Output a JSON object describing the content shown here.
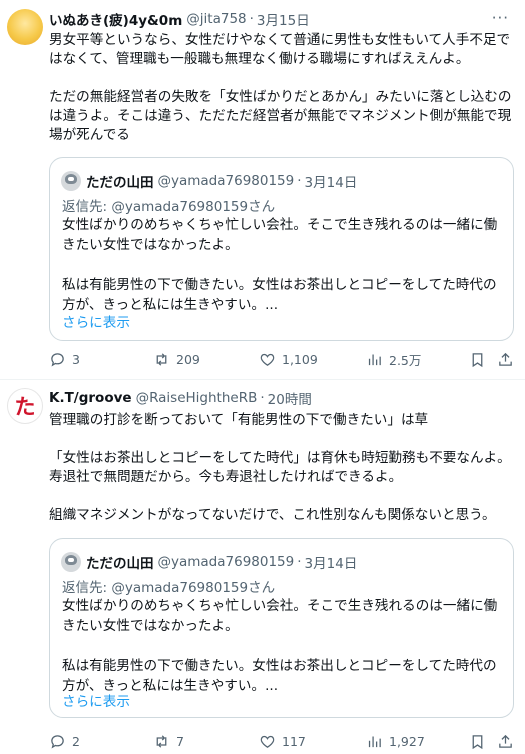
{
  "tweets": [
    {
      "display_name": "いぬあき(疲)4y&0m",
      "handle": "@jita758",
      "time": "3月15日",
      "text": "男女平等というなら、女性だけやなくて普通に男性も女性もいて人手不足ではなくて、管理職も一般職も無理なく働ける職場にすればええんよ。\n\nただの無能経営者の失敗を「女性ばかりだとあかん」みたいに落とし込むのは違うよ。そこは違う、ただただ経営者が無能でマネジメント側が無能で現場が死んでる",
      "quote": {
        "display_name": "ただの山田",
        "handle": "@yamada76980159",
        "time": "3月14日",
        "reply_label": "返信先: ",
        "reply_to": "@yamada76980159さん",
        "text": "女性ばかりのめちゃくちゃ忙しい会社。そこで生き残れるのは一緒に働きたい女性ではなかったよ。\n\n私は有能男性の下で働きたい。女性はお茶出しとコピーをしてた時代の方が、きっと私には生きやすい。...",
        "show_more": "さらに表示"
      },
      "stats": {
        "replies": "3",
        "retweets": "209",
        "likes": "1,109",
        "views": "2.5万"
      }
    },
    {
      "display_name": "K.T/groove",
      "handle": "@RaiseHightheRB",
      "time": "20時間",
      "avatar_glyph": "た",
      "text": "管理職の打診を断っておいて「有能男性の下で働きたい」は草\n\n「女性はお茶出しとコピーをしてた時代」は育休も時短勤務も不要なんよ。寿退社で無問題だから。今も寿退社したければできるよ。\n\n組織マネジメントがなってないだけで、これ性別なんも関係ないと思う。",
      "quote": {
        "display_name": "ただの山田",
        "handle": "@yamada76980159",
        "time": "3月14日",
        "reply_label": "返信先: ",
        "reply_to": "@yamada76980159さん",
        "text": "女性ばかりのめちゃくちゃ忙しい会社。そこで生き残れるのは一緒に働きたい女性ではなかったよ。\n\n私は有能男性の下で働きたい。女性はお茶出しとコピーをしてた時代の方が、きっと私には生きやすい。...",
        "show_more": "さらに表示"
      },
      "stats": {
        "replies": "2",
        "retweets": "7",
        "likes": "117",
        "views": "1,927"
      }
    }
  ],
  "separator": "·",
  "more_glyph": "···",
  "colors": {
    "text": "#0f1419",
    "secondary": "#536471",
    "link": "#1d9bf0",
    "border": "#cfd9de"
  },
  "icons": [
    "reply-icon",
    "retweet-icon",
    "like-icon",
    "views-icon",
    "bookmark-icon",
    "share-icon",
    "more-icon"
  ]
}
